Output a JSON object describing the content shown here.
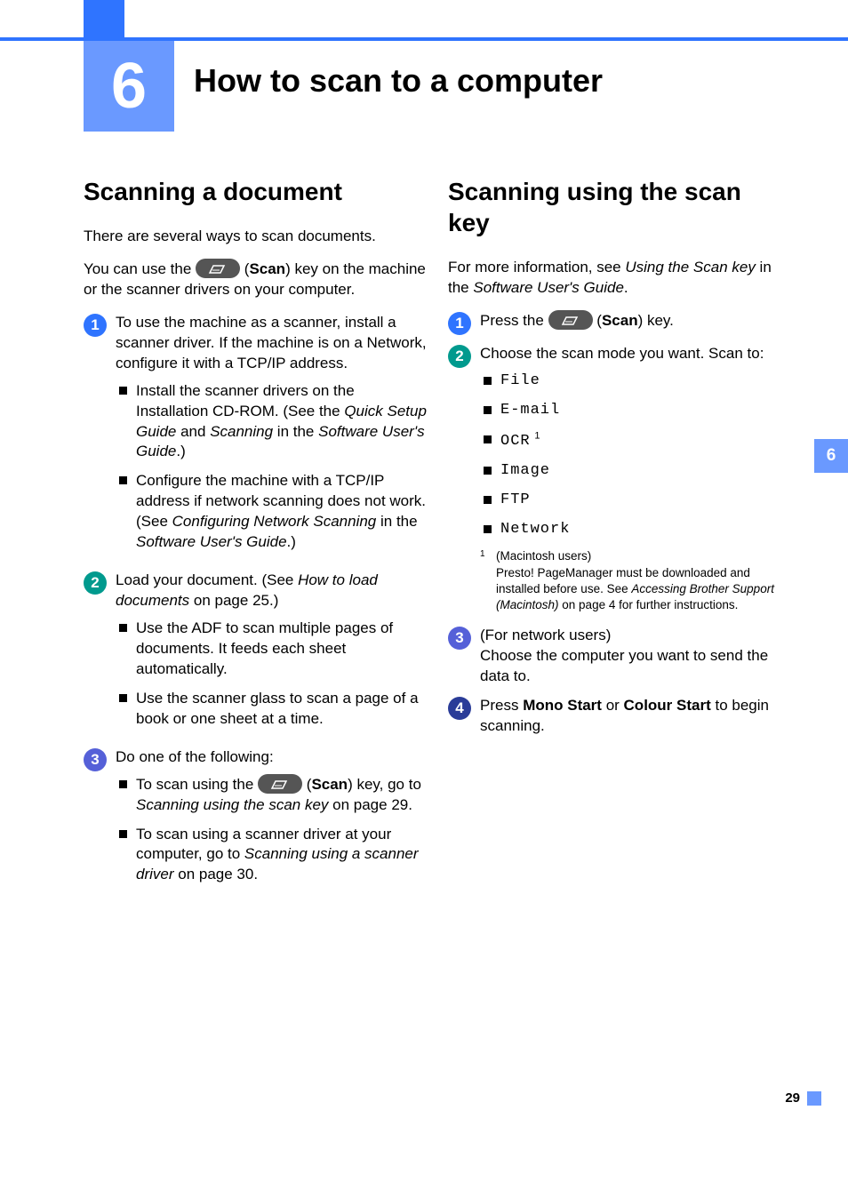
{
  "chapter": {
    "number": "6",
    "title": "How to scan to a computer"
  },
  "sideTab": "6",
  "pageNumber": "29",
  "left": {
    "heading": "Scanning a document",
    "intro1": "There are several ways to scan documents.",
    "intro2a": "You can use the ",
    "intro2b": " (",
    "intro2scan": "Scan",
    "intro2c": ") key on the machine or the scanner drivers on your computer.",
    "step1": {
      "lead": "To use the machine as a scanner, install a scanner driver. If the machine is on a Network, configure it with a TCP/IP address.",
      "b1a": "Install the scanner drivers on the Installation CD-ROM. (See the ",
      "b1i1": "Quick Setup Guide",
      "b1b": " and ",
      "b1i2": "Scanning",
      "b1c": " in the ",
      "b1i3": "Software User's Guide",
      "b1d": ".)",
      "b2a": "Configure the machine with a TCP/IP address if network scanning does not work. (See ",
      "b2i1": "Configuring Network Scanning",
      "b2b": " in the ",
      "b2i2": "Software User's Guide",
      "b2c": ".)"
    },
    "step2": {
      "leadA": "Load your document. (See ",
      "leadI": "How to load documents",
      "leadB": " on page 25.)",
      "b1": "Use the ADF to scan multiple pages of documents. It feeds each sheet automatically.",
      "b2": "Use the scanner glass to scan a page of a book or one sheet at a time."
    },
    "step3": {
      "lead": "Do one of the following:",
      "b1a": "To scan using the ",
      "b1b": " (",
      "b1scan": "Scan",
      "b1c": ") key, go to ",
      "b1i": "Scanning using the scan key",
      "b1d": " on page 29.",
      "b2a": "To scan using a scanner driver at your computer, go to ",
      "b2i": "Scanning using a scanner driver",
      "b2b": " on page 30."
    }
  },
  "right": {
    "heading": "Scanning using the scan key",
    "introA": "For more information, see ",
    "introI1": "Using the Scan key",
    "introB": " in the ",
    "introI2": "Software User's Guide",
    "introC": ".",
    "step1a": "Press the ",
    "step1b": " (",
    "step1scan": "Scan",
    "step1c": ") key.",
    "step2lead": "Choose the scan mode you want. Scan to:",
    "items": {
      "file": "File",
      "email": "E-mail",
      "ocr": "OCR",
      "ocrRef": "1",
      "image": "Image",
      "ftp": "FTP",
      "network": "Network"
    },
    "fnNum": "1",
    "fnA": "(Macintosh users)",
    "fnB": "Presto! PageManager must be downloaded and installed before use. See ",
    "fnI": "Accessing Brother Support (Macintosh)",
    "fnC": " on page 4 for further instructions.",
    "step3a": "(For network users)",
    "step3b": "Choose the computer you want to send the data to.",
    "step4a": "Press ",
    "step4m": "Mono Start",
    "step4b": " or ",
    "step4c": "Colour Start",
    "step4d": " to begin scanning."
  }
}
